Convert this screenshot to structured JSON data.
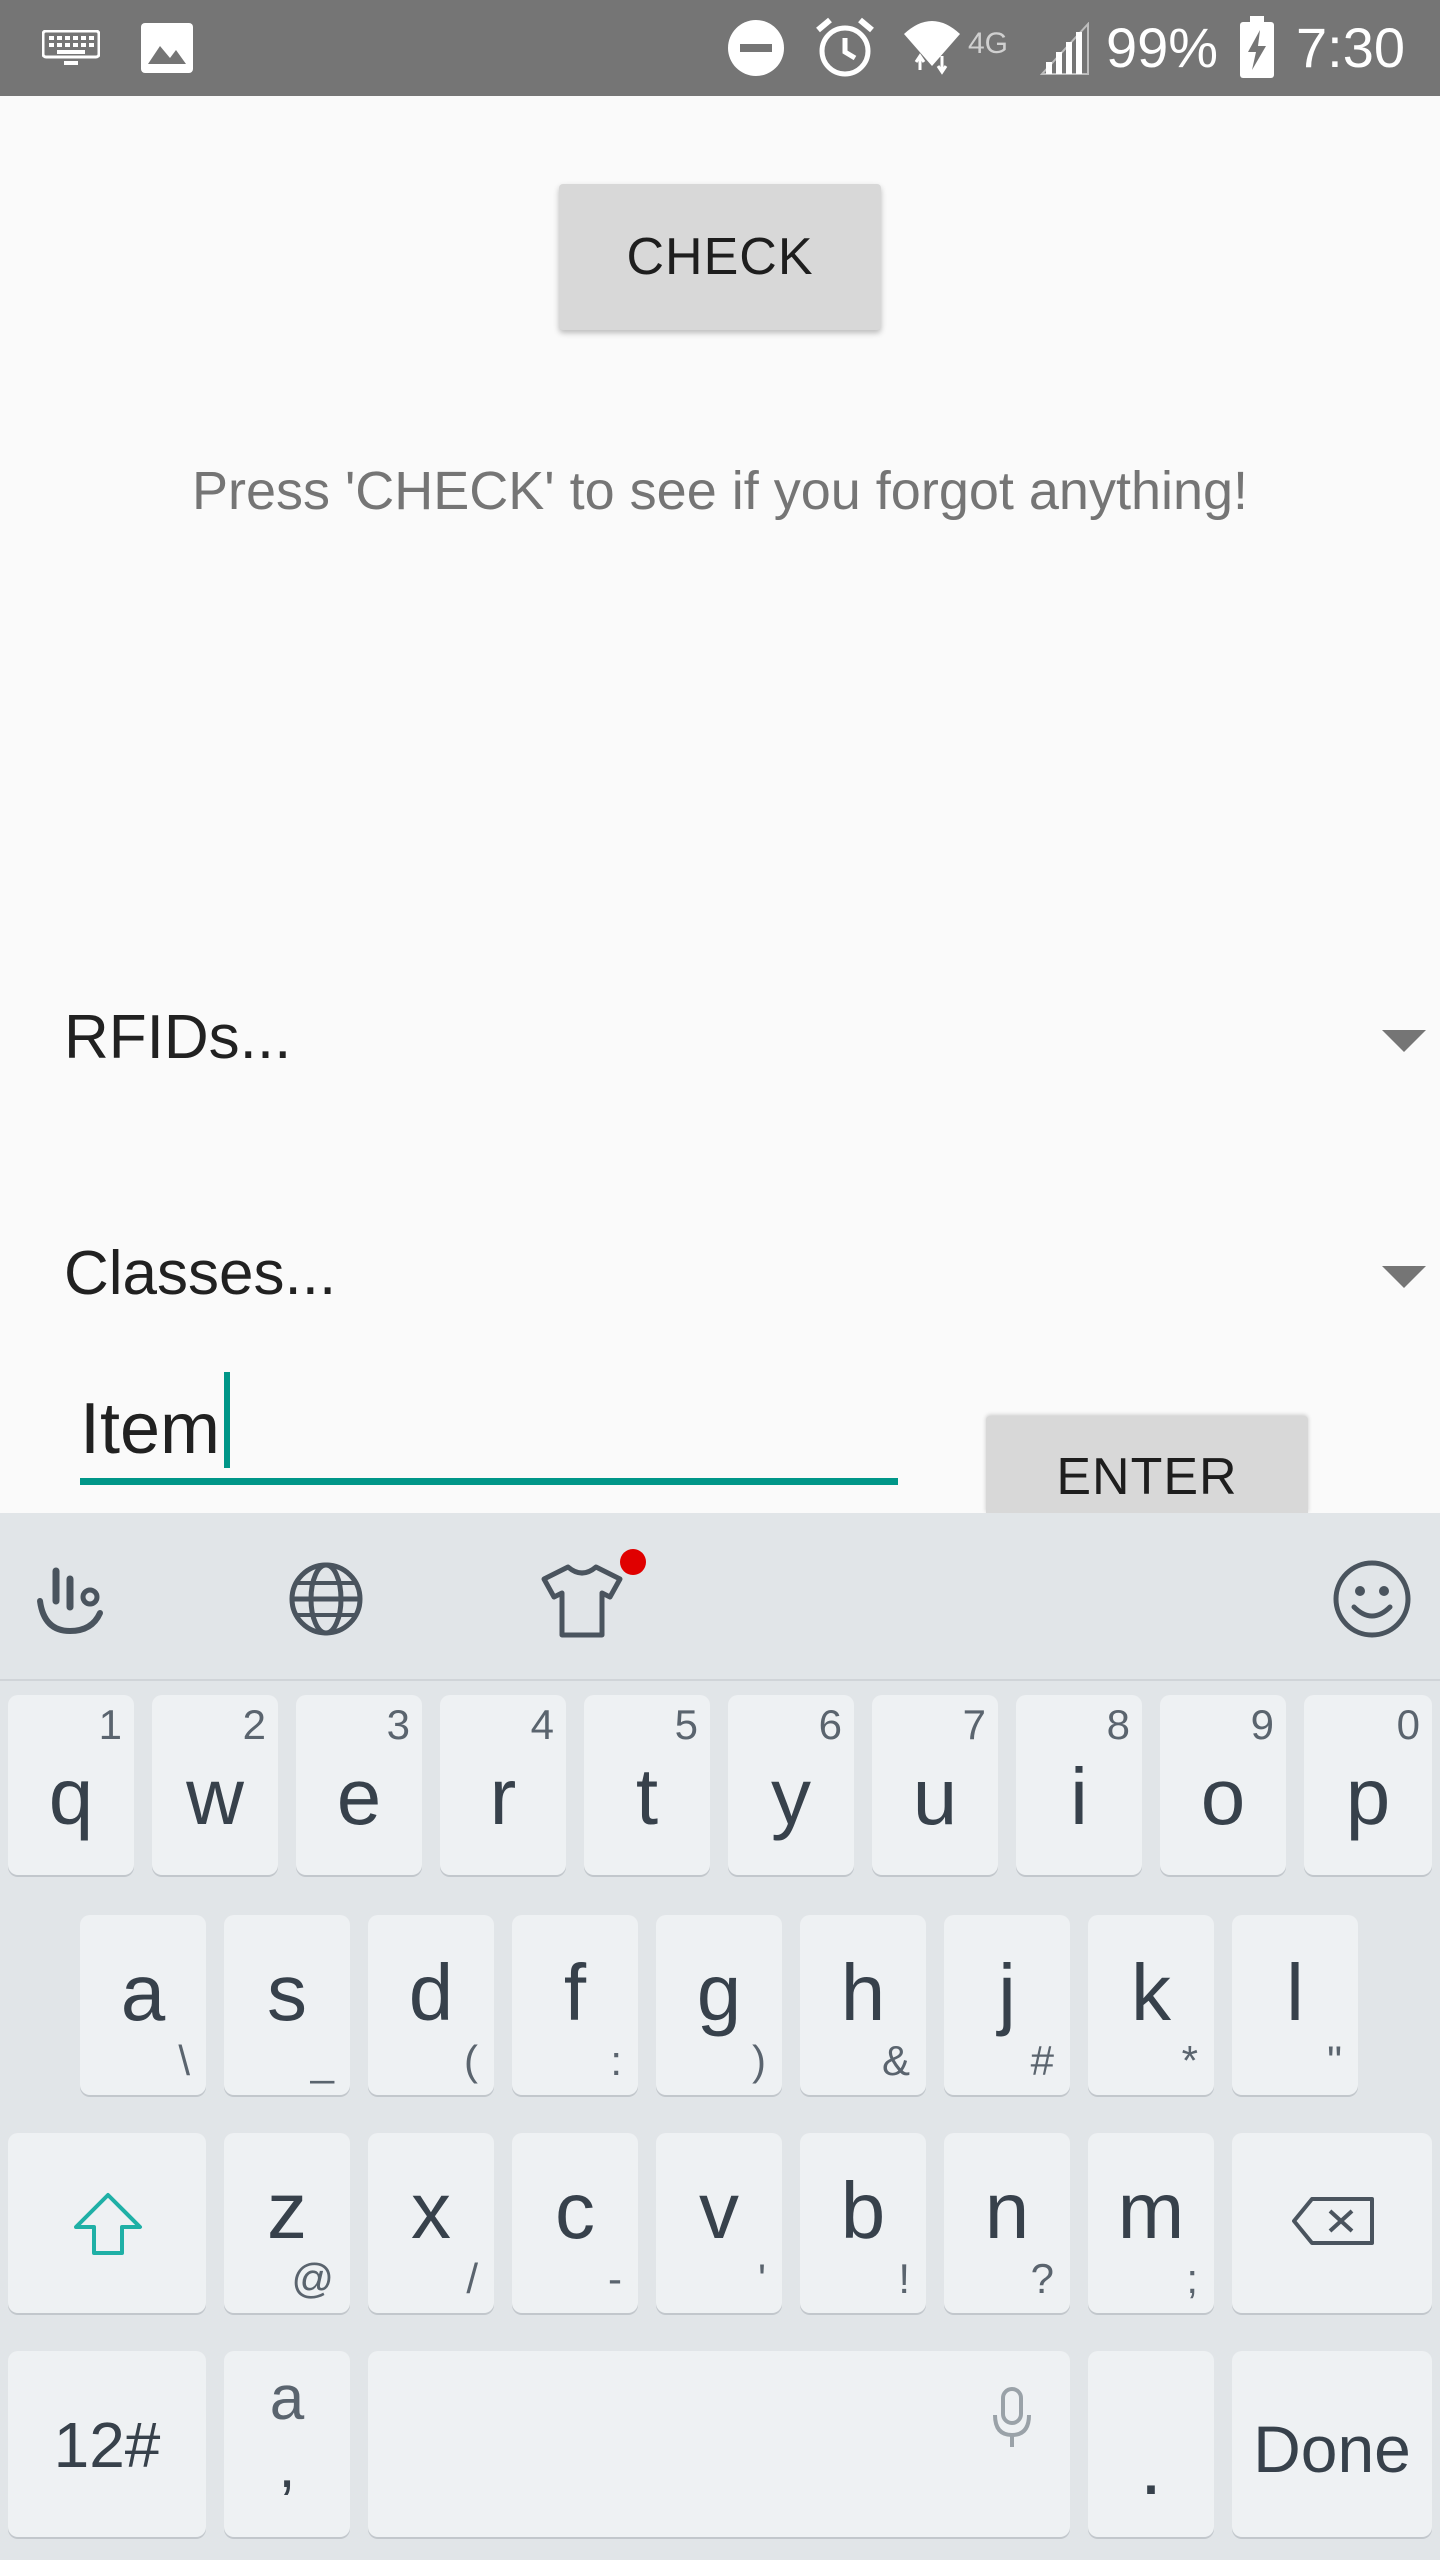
{
  "status_bar": {
    "battery_percent": "99%",
    "time": "7:30",
    "network": "4G",
    "icons": [
      "keyboard-icon",
      "image-icon",
      "do-not-disturb-icon",
      "alarm-icon",
      "wifi-icon",
      "signal-icon",
      "battery-charging-icon"
    ]
  },
  "app": {
    "check_label": "CHECK",
    "hint": "Press 'CHECK' to see if you forgot anything!",
    "rfids_spinner": "RFIDs...",
    "classes_spinner": "Classes...",
    "item_input_value": "Item",
    "enter_label": "ENTER",
    "accent_color": "#009688"
  },
  "keyboard": {
    "toolbar_icons": [
      "swipe-gesture-icon",
      "globe-icon",
      "theme-shirt-icon",
      "emoji-icon"
    ],
    "row1": [
      {
        "key": "q",
        "hint": "1"
      },
      {
        "key": "w",
        "hint": "2"
      },
      {
        "key": "e",
        "hint": "3"
      },
      {
        "key": "r",
        "hint": "4"
      },
      {
        "key": "t",
        "hint": "5"
      },
      {
        "key": "y",
        "hint": "6"
      },
      {
        "key": "u",
        "hint": "7"
      },
      {
        "key": "i",
        "hint": "8"
      },
      {
        "key": "o",
        "hint": "9"
      },
      {
        "key": "p",
        "hint": "0"
      }
    ],
    "row2": [
      {
        "key": "a",
        "hint": "\\"
      },
      {
        "key": "s",
        "hint": "_"
      },
      {
        "key": "d",
        "hint": "("
      },
      {
        "key": "f",
        "hint": ":"
      },
      {
        "key": "g",
        "hint": ")"
      },
      {
        "key": "h",
        "hint": "&"
      },
      {
        "key": "j",
        "hint": "#"
      },
      {
        "key": "k",
        "hint": "*"
      },
      {
        "key": "l",
        "hint": "\""
      }
    ],
    "row3": [
      {
        "key": "z",
        "hint": "@"
      },
      {
        "key": "x",
        "hint": "/"
      },
      {
        "key": "c",
        "hint": "-"
      },
      {
        "key": "v",
        "hint": "'"
      },
      {
        "key": "b",
        "hint": "!"
      },
      {
        "key": "n",
        "hint": "?"
      },
      {
        "key": "m",
        "hint": ";"
      }
    ],
    "numbers_key": "12#",
    "lang_key_top": "a",
    "lang_key_bottom": ",",
    "period_key": ".",
    "done_key": "Done"
  }
}
